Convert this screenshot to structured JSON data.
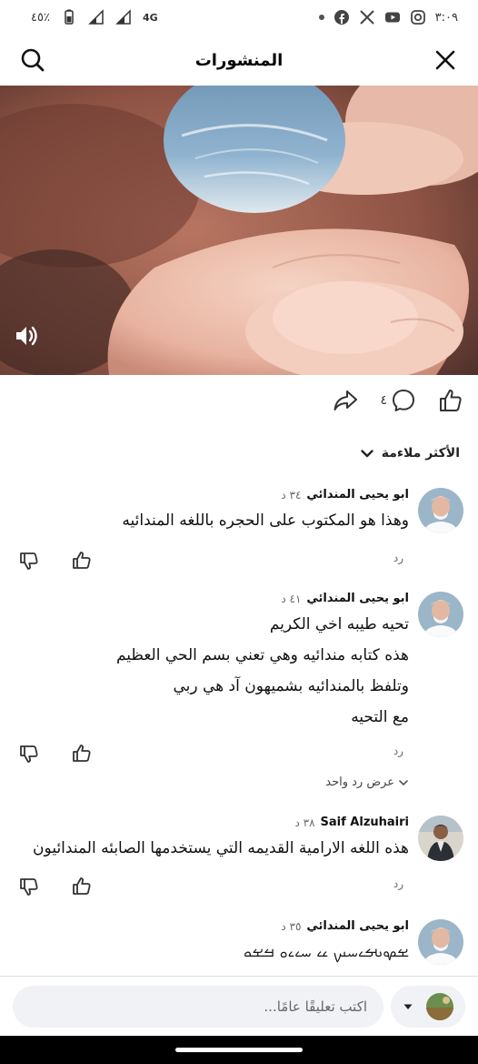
{
  "status_bar": {
    "time": "٣:٠٩",
    "battery": "٤٥٪",
    "network": "4G"
  },
  "header": {
    "title": "المنشورات"
  },
  "post": {
    "comment_count": "٤"
  },
  "sort": {
    "label": "الأكثر ملاءمة"
  },
  "comments": [
    {
      "author": "ابو يحيى المندائي",
      "time": "٣٤ د",
      "lines": [
        "وهذا هو المكتوب على الحجره باللغه المندائيه"
      ],
      "reply_label": "رد"
    },
    {
      "author": "ابو يحيى المندائي",
      "time": "٤١ د",
      "lines": [
        "تحيه طيبه اخي الكريم",
        "هذه كتابه مندائيه وهي تعني بسم الحي العظيم",
        "وتلفظ بالمندائيه بشميهون آد هي ربي",
        "مع التحيه"
      ],
      "reply_label": "رد",
      "view_replies": "عرض رد واحد"
    },
    {
      "author": "Saif Alzuhairi",
      "time": "٣٨ د",
      "lines": [
        "هذه اللغه الارامية القديمه التي يستخدمها الصابئه المندائيون"
      ],
      "reply_label": "رد"
    },
    {
      "author": "ابو يحيى المندائي",
      "time": "٣٥ د",
      "lines": [
        "ࡁࡔࡅࡌࡉࡄࡅࡍ ࡖ ࡄࡉࡉࡀ ࡓࡁࡀ"
      ]
    }
  ],
  "composer": {
    "placeholder": "اكتب تعليقًا عامًا..."
  }
}
